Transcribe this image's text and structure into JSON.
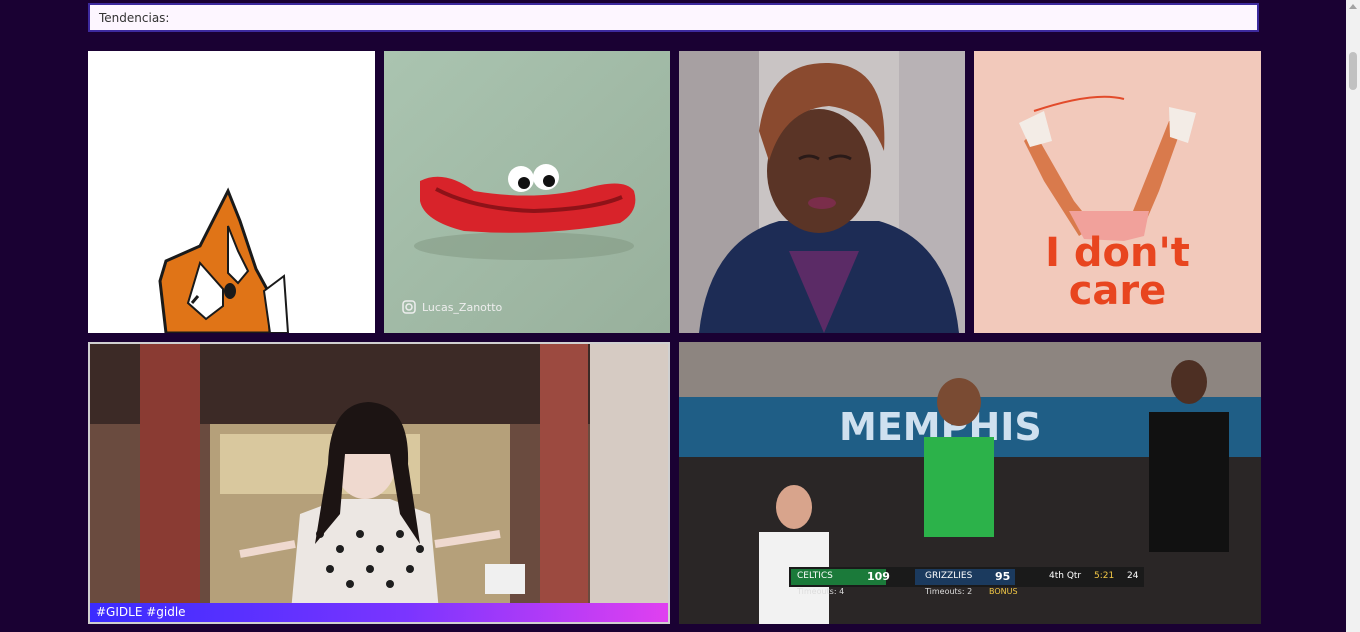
{
  "section": {
    "title": "Tendencias:"
  },
  "gifs": [
    {
      "alt": "fox sticker",
      "caption": ""
    },
    {
      "alt": "red lips with googly eyes",
      "watermark": "Lucas_Zanotto",
      "caption": ""
    },
    {
      "alt": "woman eyes closed",
      "caption": ""
    },
    {
      "alt": "legs kicking",
      "overlay_text_line1": "I don't",
      "overlay_text_line2": "care",
      "caption": ""
    },
    {
      "alt": "woman in polka dot dress",
      "caption": "#GIDLE #gidle"
    },
    {
      "alt": "basketball bench celebration",
      "caption": "",
      "scoreboard": {
        "team1": "CELTICS",
        "score1": "109",
        "team2": "GRIZZLIES",
        "score2": "95",
        "quarter": "4th Qtr",
        "clock": "5:21",
        "shot": "24",
        "timeouts1": "Timeouts: 4",
        "timeouts2": "Timeouts: 2",
        "bonus": "BONUS"
      }
    }
  ],
  "colors": {
    "background": "#1a0133",
    "search_border": "#3d2a9e",
    "caption_gradient_start": "#3a2cff",
    "caption_gradient_end": "#e040f0"
  }
}
